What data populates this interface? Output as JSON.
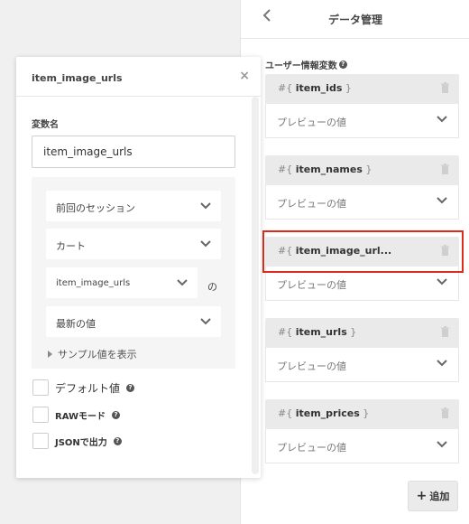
{
  "right_panel": {
    "back_icon": "chevron-left-icon",
    "title": "データ管理",
    "section_label": "ユーザー情報変数",
    "variables": [
      {
        "prefix": "#{",
        "name": "item_ids",
        "suffix": "}",
        "preview": "プレビューの値"
      },
      {
        "prefix": "#{",
        "name": "item_names",
        "suffix": "}",
        "preview": "プレビューの値"
      },
      {
        "prefix": "#{",
        "name": "item_image_url...",
        "suffix": "",
        "preview": "プレビューの値"
      },
      {
        "prefix": "#{",
        "name": "item_urls",
        "suffix": "}",
        "preview": "プレビューの値"
      },
      {
        "prefix": "#{",
        "name": "item_prices",
        "suffix": "}",
        "preview": "プレビューの値"
      }
    ],
    "add_button": {
      "icon": "+",
      "label": "追加"
    }
  },
  "popup": {
    "title": "item_image_urls",
    "close_icon": "×",
    "variable_name_label": "変数名",
    "variable_name_value": "item_image_urls",
    "selects": {
      "session": "前回のセッション",
      "cart": "カート",
      "field": "item_image_urls",
      "of_label": "の",
      "value": "最新の値"
    },
    "sample_toggle": "サンプル値を表示",
    "checkboxes": {
      "default_value": "デフォルト値",
      "raw_mode": "RAWモード",
      "json_output": "JSONで出力"
    }
  },
  "colors": {
    "highlight": "#e02a1c",
    "card_header": "#eaeaea",
    "accent_text": "#333333"
  }
}
